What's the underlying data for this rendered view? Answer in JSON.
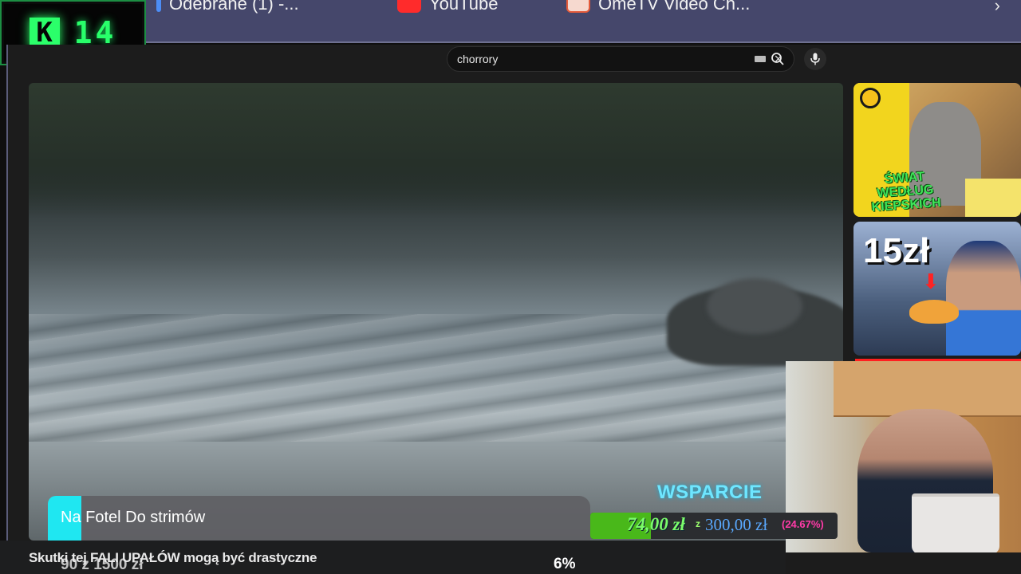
{
  "browser": {
    "tabs": [
      {
        "label": "Odebrane (1) -...",
        "icon": "gmail-icon"
      },
      {
        "label": "YouTube",
        "icon": "youtube-icon"
      },
      {
        "label": "OmeTV Video Ch...",
        "icon": "ometv-icon"
      }
    ],
    "more_icon": "chevron-right-icon"
  },
  "logo": {
    "letter": "K",
    "number": "14",
    "color": "#28ff6a"
  },
  "youtube": {
    "search": {
      "value": "chorrory"
    }
  },
  "sidebar": {
    "videos": [
      {
        "thumbnail_text": "ŚWIAT WEDŁUG KIEPSKICH"
      },
      {
        "thumbnail_text": "15zł"
      }
    ]
  },
  "overlay": {
    "notification": "Na Fotel Do strimów",
    "ticker": "Skutki tej FALI UPAŁÓW mogą być drastyczne",
    "goal_text": "90 z 1500 zł",
    "goal_percent": "6%",
    "support": {
      "title": "WSPARCIE",
      "current": "74,00 zł",
      "separator": "z",
      "goal": "300,00 zł",
      "percent": "(24.67%)",
      "fill_fraction": 0.2467,
      "title_color": "#6ee6ff",
      "fill_color": "#49b81a",
      "percent_color": "#ff3aa8"
    }
  }
}
